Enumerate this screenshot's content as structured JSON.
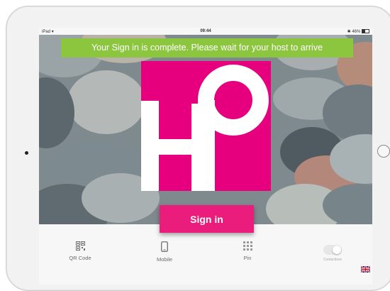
{
  "status_bar": {
    "device": "iPad",
    "time": "09:44",
    "battery": "46%"
  },
  "banner": {
    "text": "Your Sign in is complete. Please wait for your host to arrive",
    "color": "#8cc63f"
  },
  "logo": {
    "text": "HP",
    "color": "#e6007e"
  },
  "signin_button": {
    "label": "Sign in",
    "color": "#ea1d7c"
  },
  "options": [
    {
      "label": "QR Code",
      "icon": "qr-code-icon"
    },
    {
      "label": "Mobile",
      "icon": "mobile-phone-icon"
    },
    {
      "label": "Pin",
      "icon": "keypad-icon"
    },
    {
      "label": "Contactless",
      "icon": "toggle-switch",
      "enabled": false
    }
  ],
  "language": {
    "icon": "uk-flag-icon"
  }
}
